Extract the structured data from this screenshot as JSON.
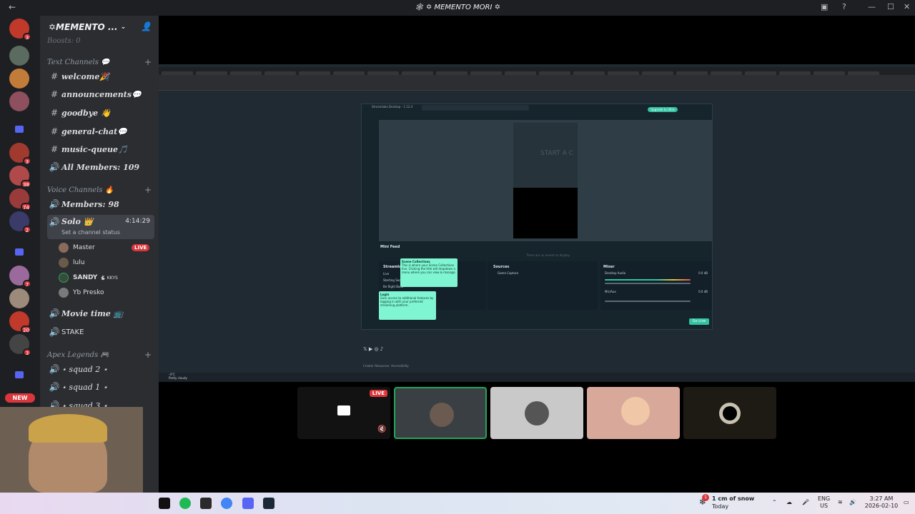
{
  "window": {
    "title": "🕸 ✡ MEMENTO MORI ✡"
  },
  "server": {
    "name": "✡MEMENTO ...",
    "boosts_label": "Boosts: 0"
  },
  "categories": {
    "text": "Text Channels 💬",
    "voice": "Voice Channels 🔥",
    "apex": "Apex Legends 🎮"
  },
  "text_channels": [
    "welcome🎉",
    "announcements💬",
    "goodbye 👋",
    "general-chat💬",
    "music-queue🎵"
  ],
  "voice_channels": {
    "all_members": "All Members: 109",
    "members": "Members: 98",
    "solo": "Solo 👑",
    "solo_time": "4:14:29",
    "status": "Set a channel status",
    "movie": "Movie time 📺",
    "stake": "STAKE",
    "squad2": "⋆ squad 2 ⋆",
    "squad1": "⋆ squad 1 ⋆",
    "squad3": "⋆ squad 3 ⋆"
  },
  "voice_users": [
    {
      "name": "Master",
      "live": "LIVE"
    },
    {
      "name": "lulu"
    },
    {
      "name": "SANDY",
      "tag": "🐇 KKYS"
    },
    {
      "name": "Yb Presko"
    }
  ],
  "guild_badges": [
    "3",
    "3",
    "38",
    "74",
    "2",
    "7",
    "20",
    "3"
  ],
  "new_label": "NEW",
  "streamlabs": {
    "app_title": "Streamlabs Desktop - 1.12.4",
    "preview_text": "START A C",
    "upgrade": "Upgrade to Ultra",
    "mini_feed": "Mini Feed",
    "mini_feed_empty": "There are no events to display",
    "scenes": "Streamlabs",
    "sources": "Sources",
    "mixer": "Mixer",
    "scene_items": [
      "Live",
      "Starting Soon",
      "Be Right Back"
    ],
    "source_items": [
      "Game Capture"
    ],
    "mixer_items": [
      "Desktop Audio",
      "Mic/Aux"
    ],
    "mixer_db": [
      "0.0 dB",
      "0.0 dB"
    ],
    "tip1_title": "Scene Collections",
    "tip1_body": "This is where your Scene Collections live. Clicking the title will dropdown a menu where you can view & manage.",
    "tip2_title": "Login",
    "tip2_body": "Gain access to additional features by logging in with your preferred streaming platform.",
    "go_live": "Go Live"
  },
  "web_links": [
    "Creator Resources",
    "Accessibility"
  ],
  "tiles": [
    {
      "label": "LIVE"
    },
    {},
    {},
    {},
    {}
  ],
  "taskbar": {
    "weather": "1 cm of snow",
    "weather_sub": "Today",
    "weather_badge": "1",
    "lang": "ENG",
    "region": "US",
    "time": "3:27 AM",
    "date": "2026-02-10"
  },
  "inner_task": {
    "temp": "-4°C",
    "weather": "Partly cloudy"
  }
}
